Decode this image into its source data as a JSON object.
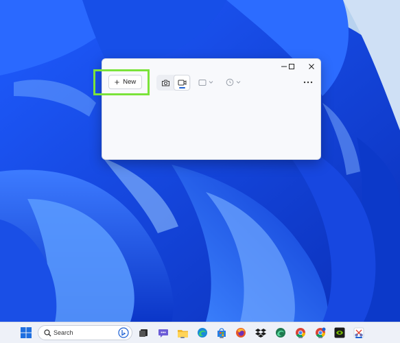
{
  "snipping_tool": {
    "new_button_label": "New",
    "mode_buttons": [
      "camera-icon",
      "video-camera-icon"
    ],
    "selected_mode": "video",
    "dropdowns": [
      "rectangle-shape-icon",
      "timer-clock-icon"
    ],
    "caption_buttons": [
      "minimize",
      "maximize",
      "close"
    ],
    "more_options_icon": "ellipsis-icon"
  },
  "taskbar": {
    "search_placeholder": "Search",
    "apps": [
      "windows-start-icon",
      "bing-icon",
      "task-view-icon",
      "teams-chat-icon",
      "file-explorer-icon",
      "edge-icon",
      "microsoft-store-icon",
      "firefox-icon",
      "dropbox-icon",
      "edge-dev-icon",
      "chrome-icon",
      "chrome-beta-icon",
      "nvidia-icon",
      "snipping-tool-icon"
    ]
  },
  "annotation": {
    "highlight_color": "#7be33a"
  },
  "colors": {
    "accent": "#1a5fd3",
    "window_bg": "#f8f9fc",
    "taskbar_bg": "#eef1f8"
  }
}
